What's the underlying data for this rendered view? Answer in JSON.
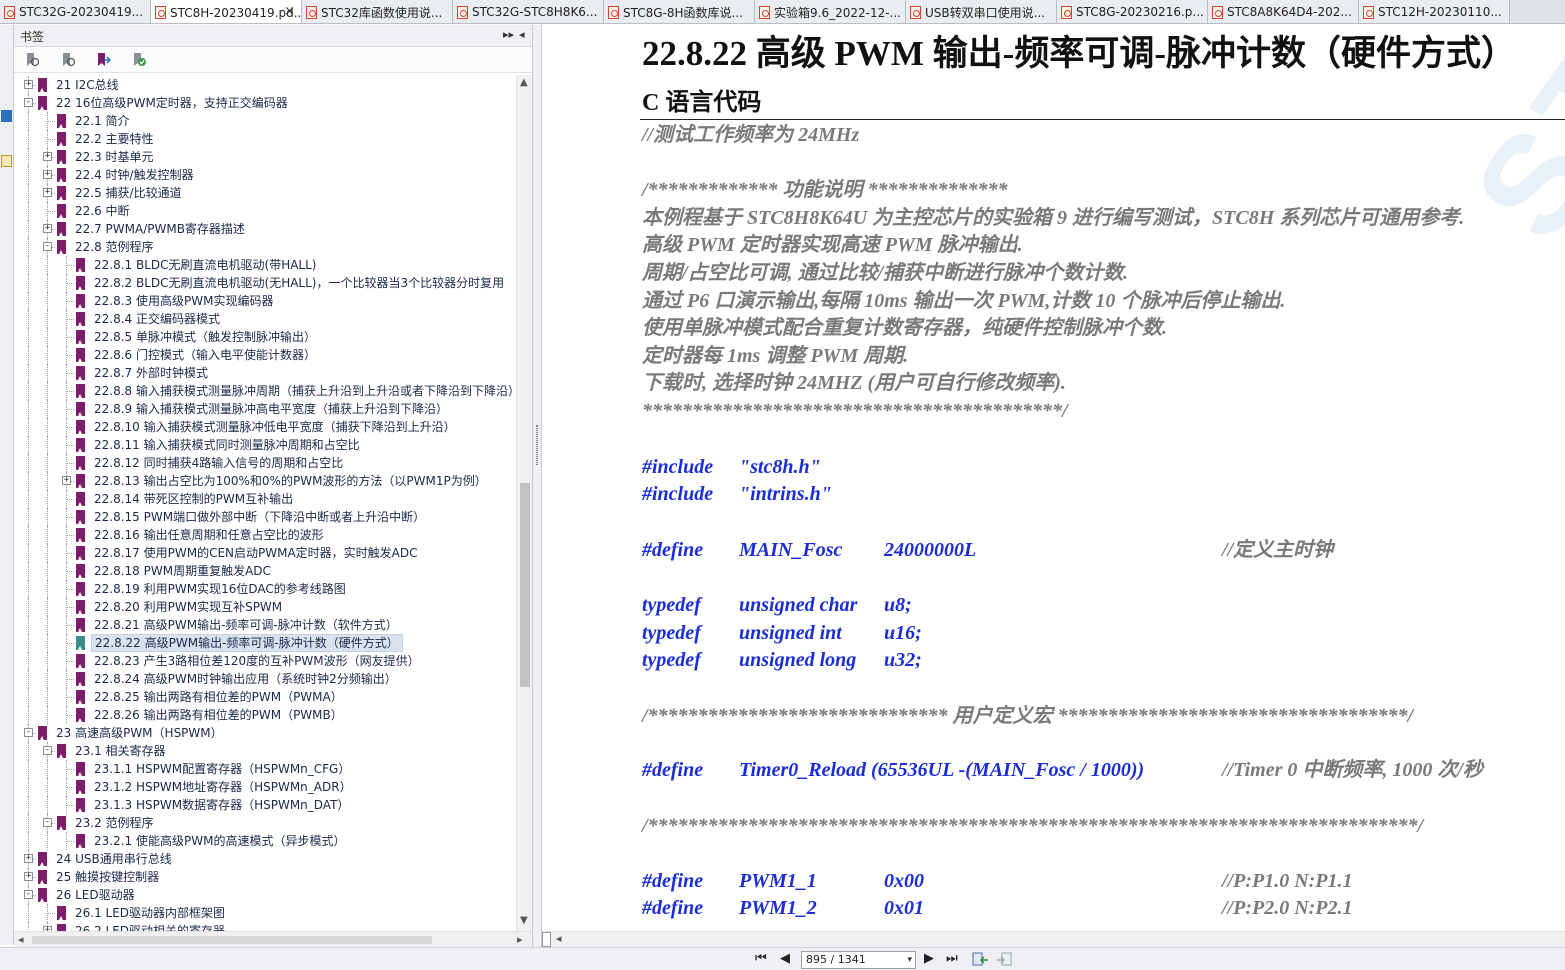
{
  "tabs": [
    {
      "label": "STC32G-20230419...",
      "active": false
    },
    {
      "label": "STC8H-20230419.pd...",
      "active": true
    },
    {
      "label": "STC32库函数使用说...",
      "active": false
    },
    {
      "label": "STC32G-STC8H8K6...",
      "active": false
    },
    {
      "label": "STC8G-8H函数库说...",
      "active": false
    },
    {
      "label": "实验箱9.6_2022-12-...",
      "active": false
    },
    {
      "label": "USB转双串口使用说...",
      "active": false
    },
    {
      "label": "STC8G-20230216.p...",
      "active": false
    },
    {
      "label": "STC8A8K64D4-202...",
      "active": false
    },
    {
      "label": "STC12H-20230110...",
      "active": false
    }
  ],
  "tab_close_glyph": "×",
  "bookmarks_panel": {
    "title": "书签",
    "collapse_glyph": "▸▸",
    "close_glyph": "◂",
    "toolbar_icons": [
      "bookmark-options-icon",
      "bookmark-expand-icon",
      "bookmark-goto-icon",
      "bookmark-check-icon"
    ],
    "items": [
      {
        "label": "21 I2C总线",
        "level": 0,
        "expander": "+"
      },
      {
        "label": "22 16位高级PWM定时器，支持正交编码器",
        "level": 0,
        "expander": "-"
      },
      {
        "label": "22.1 简介",
        "level": 1,
        "expander": ""
      },
      {
        "label": "22.2 主要特性",
        "level": 1,
        "expander": ""
      },
      {
        "label": "22.3 时基单元",
        "level": 1,
        "expander": "+"
      },
      {
        "label": "22.4 时钟/触发控制器",
        "level": 1,
        "expander": "+"
      },
      {
        "label": "22.5 捕获/比较通道",
        "level": 1,
        "expander": "+"
      },
      {
        "label": "22.6 中断",
        "level": 1,
        "expander": ""
      },
      {
        "label": "22.7 PWMA/PWMB寄存器描述",
        "level": 1,
        "expander": "+"
      },
      {
        "label": "22.8 范例程序",
        "level": 1,
        "expander": "-"
      },
      {
        "label": "22.8.1 BLDC无刷直流电机驱动(带HALL)",
        "level": 2,
        "expander": ""
      },
      {
        "label": "22.8.2 BLDC无刷直流电机驱动(无HALL)，一个比较器当3个比较器分时复用",
        "level": 2,
        "expander": ""
      },
      {
        "label": "22.8.3 使用高级PWM实现编码器",
        "level": 2,
        "expander": ""
      },
      {
        "label": "22.8.4 正交编码器模式",
        "level": 2,
        "expander": ""
      },
      {
        "label": "22.8.5 单脉冲模式（触发控制脉冲输出）",
        "level": 2,
        "expander": ""
      },
      {
        "label": "22.8.6 门控模式（输入电平使能计数器）",
        "level": 2,
        "expander": ""
      },
      {
        "label": "22.8.7 外部时钟模式",
        "level": 2,
        "expander": ""
      },
      {
        "label": "22.8.8 输入捕获模式测量脉冲周期（捕获上升沿到上升沿或者下降沿到下降沿）",
        "level": 2,
        "expander": ""
      },
      {
        "label": "22.8.9 输入捕获模式测量脉冲高电平宽度（捕获上升沿到下降沿）",
        "level": 2,
        "expander": ""
      },
      {
        "label": "22.8.10 输入捕获模式测量脉冲低电平宽度（捕获下降沿到上升沿）",
        "level": 2,
        "expander": ""
      },
      {
        "label": "22.8.11 输入捕获模式同时测量脉冲周期和占空比",
        "level": 2,
        "expander": ""
      },
      {
        "label": "22.8.12 同时捕获4路输入信号的周期和占空比",
        "level": 2,
        "expander": ""
      },
      {
        "label": "22.8.13 输出占空比为100%和0%的PWM波形的方法（以PWM1P为例）",
        "level": 2,
        "expander": "+"
      },
      {
        "label": "22.8.14 带死区控制的PWM互补输出",
        "level": 2,
        "expander": ""
      },
      {
        "label": "22.8.15 PWM端口做外部中断（下降沿中断或者上升沿中断）",
        "level": 2,
        "expander": ""
      },
      {
        "label": "22.8.16 输出任意周期和任意占空比的波形",
        "level": 2,
        "expander": ""
      },
      {
        "label": "22.8.17 使用PWM的CEN启动PWMA定时器，实时触发ADC",
        "level": 2,
        "expander": ""
      },
      {
        "label": "22.8.18 PWM周期重复触发ADC",
        "level": 2,
        "expander": ""
      },
      {
        "label": "22.8.19 利用PWM实现16位DAC的参考线路图",
        "level": 2,
        "expander": ""
      },
      {
        "label": "22.8.20 利用PWM实现互补SPWM",
        "level": 2,
        "expander": ""
      },
      {
        "label": "22.8.21 高级PWM输出-频率可调-脉冲计数（软件方式）",
        "level": 2,
        "expander": ""
      },
      {
        "label": "22.8.22 高级PWM输出-频率可调-脉冲计数（硬件方式）",
        "level": 2,
        "expander": "",
        "selected": true
      },
      {
        "label": "22.8.23 产生3路相位差120度的互补PWM波形（网友提供）",
        "level": 2,
        "expander": ""
      },
      {
        "label": "22.8.24 高级PWM时钟输出应用（系统时钟2分频输出）",
        "level": 2,
        "expander": ""
      },
      {
        "label": "22.8.25 输出两路有相位差的PWM（PWMA）",
        "level": 2,
        "expander": ""
      },
      {
        "label": "22.8.26 输出两路有相位差的PWM（PWMB）",
        "level": 2,
        "expander": ""
      },
      {
        "label": "23 高速高级PWM（HSPWM）",
        "level": 0,
        "expander": "-"
      },
      {
        "label": "23.1 相关寄存器",
        "level": 1,
        "expander": "-"
      },
      {
        "label": "23.1.1 HSPWM配置寄存器（HSPWMn_CFG）",
        "level": 2,
        "expander": ""
      },
      {
        "label": "23.1.2 HSPWM地址寄存器（HSPWMn_ADR）",
        "level": 2,
        "expander": ""
      },
      {
        "label": "23.1.3 HSPWM数据寄存器（HSPWMn_DAT）",
        "level": 2,
        "expander": ""
      },
      {
        "label": "23.2 范例程序",
        "level": 1,
        "expander": "-"
      },
      {
        "label": "23.2.1 使能高级PWM的高速模式（异步模式）",
        "level": 2,
        "expander": ""
      },
      {
        "label": "24 USB通用串行总线",
        "level": 0,
        "expander": "+"
      },
      {
        "label": "25 触摸按键控制器",
        "level": 0,
        "expander": "+"
      },
      {
        "label": "26 LED驱动器",
        "level": 0,
        "expander": "-"
      },
      {
        "label": "26.1 LED驱动器内部框架图",
        "level": 1,
        "expander": ""
      },
      {
        "label": "26.2 LED驱动相关的寄存器",
        "level": 1,
        "expander": "+"
      }
    ]
  },
  "document": {
    "section_title": "22.8.22   高级 PWM 输出-频率可调-脉冲计数（硬件方式）",
    "subsection_title": "C 语言代码",
    "watermark": "STC MC",
    "code_lines": [
      {
        "parts": [
          {
            "text": "//测试工作频率为 24MHz",
            "style": "cm"
          }
        ]
      },
      {
        "parts": [
          {
            "text": "/************* 功能说明  **************",
            "style": "cm"
          }
        ]
      },
      {
        "parts": [
          {
            "text": "本例程基于 STC8H8K64U 为主控芯片的实验箱 9 进行编写测试，STC8H 系列芯片可通用参考.",
            "style": "cm"
          }
        ]
      },
      {
        "parts": [
          {
            "text": "高级 PWM 定时器实现高速 PWM 脉冲输出.",
            "style": "cm"
          }
        ]
      },
      {
        "parts": [
          {
            "text": "周期/占空比可调, 通过比较/捕获中断进行脉冲个数计数.",
            "style": "cm"
          }
        ]
      },
      {
        "parts": [
          {
            "text": "通过 P6 口演示输出,每隔 10ms 输出一次 PWM,计数 10 个脉冲后停止输出.",
            "style": "cm"
          }
        ]
      },
      {
        "parts": [
          {
            "text": "使用单脉冲模式配合重复计数寄存器，纯硬件控制脉冲个数.",
            "style": "cm"
          }
        ]
      },
      {
        "parts": [
          {
            "text": "定时器每 1ms 调整 PWM 周期.",
            "style": "cm"
          }
        ]
      },
      {
        "parts": [
          {
            "text": "下载时,    选择时钟  24MHZ (用户可自行修改频率).",
            "style": "cm"
          }
        ]
      },
      {
        "parts": [
          {
            "text": "******************************************/",
            "style": "cm"
          }
        ]
      },
      {
        "parts": [
          {
            "text": "#include",
            "style": "kw"
          },
          {
            "text": "\"stc8h.h\"",
            "style": "tx"
          }
        ]
      },
      {
        "parts": [
          {
            "text": "#include",
            "style": "kw"
          },
          {
            "text": "\"intrins.h\"",
            "style": "tx"
          }
        ]
      },
      {
        "parts": [
          {
            "text": "#define",
            "style": "kw"
          },
          {
            "text": "MAIN_Fosc",
            "style": "tx"
          },
          {
            "text": "24000000L",
            "style": "tx"
          },
          {
            "text": "//定义主时钟",
            "style": "cm"
          }
        ]
      },
      {
        "parts": [
          {
            "text": "typedef",
            "style": "kw"
          },
          {
            "text": "unsigned char",
            "style": "tx"
          },
          {
            "text": "u8;",
            "style": "tx"
          }
        ]
      },
      {
        "parts": [
          {
            "text": "typedef",
            "style": "kw"
          },
          {
            "text": "unsigned int",
            "style": "tx"
          },
          {
            "text": "u16;",
            "style": "tx"
          }
        ]
      },
      {
        "parts": [
          {
            "text": "typedef",
            "style": "kw"
          },
          {
            "text": "unsigned long",
            "style": "tx"
          },
          {
            "text": "u32;",
            "style": "tx"
          }
        ]
      },
      {
        "parts": [
          {
            "text": "/****************************** 用户定义宏 ***********************************/",
            "style": "cm"
          }
        ]
      },
      {
        "parts": [
          {
            "text": "#define",
            "style": "kw"
          },
          {
            "text": "Timer0_Reload  (65536UL -(MAIN_Fosc / 1000))",
            "style": "tx"
          },
          {
            "text": "//Timer 0  中断频率, 1000 次/秒",
            "style": "cm"
          }
        ]
      },
      {
        "parts": [
          {
            "text": "/*****************************************************************************/",
            "style": "cm"
          }
        ]
      },
      {
        "parts": [
          {
            "text": "#define",
            "style": "kw"
          },
          {
            "text": "PWM1_1",
            "style": "tx"
          },
          {
            "text": "0x00",
            "style": "tx"
          },
          {
            "text": "//P:P1.0    N:P1.1",
            "style": "cm"
          }
        ]
      },
      {
        "parts": [
          {
            "text": "#define",
            "style": "kw"
          },
          {
            "text": "PWM1_2",
            "style": "tx"
          },
          {
            "text": "0x01",
            "style": "tx"
          },
          {
            "text": "//P:P2.0    N:P2.1",
            "style": "cm"
          }
        ]
      }
    ]
  },
  "statusbar": {
    "page_indicator": "895 / 1341",
    "first_glyph": "⏮",
    "prev_glyph": "◀",
    "next_glyph": "▶",
    "last_glyph": "⏭"
  }
}
